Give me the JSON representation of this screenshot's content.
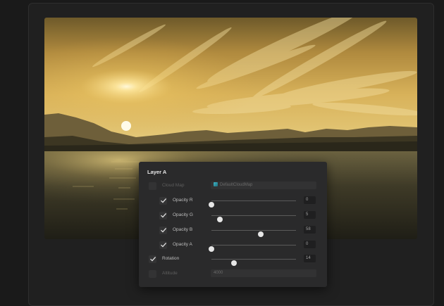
{
  "panel": {
    "title": "Layer A",
    "cloud_map": {
      "label": "Cloud Map",
      "checked": false,
      "enabled": false,
      "value": "DefaultCloudMap",
      "icon": "texture-icon"
    },
    "sliders": [
      {
        "label": "Opacity R",
        "value": "0",
        "level": 0.0,
        "checked": true,
        "indent": true
      },
      {
        "label": "Opacity G",
        "value": "5",
        "level": 0.1,
        "checked": true,
        "indent": true
      },
      {
        "label": "Opacity B",
        "value": "58",
        "level": 0.58,
        "checked": true,
        "indent": true
      },
      {
        "label": "Opacity A",
        "value": "0",
        "level": 0.0,
        "checked": true,
        "indent": true
      },
      {
        "label": "Rotation",
        "value": "14",
        "level": 0.27,
        "checked": true,
        "indent": false
      }
    ],
    "altitude": {
      "label": "Altitude",
      "checked": false,
      "enabled": false,
      "value": "4000"
    }
  },
  "colors": {
    "panel_bg": "#2a2a2b",
    "accent_icon": "#3fb6c8",
    "thumb": "#e6e6e6"
  }
}
